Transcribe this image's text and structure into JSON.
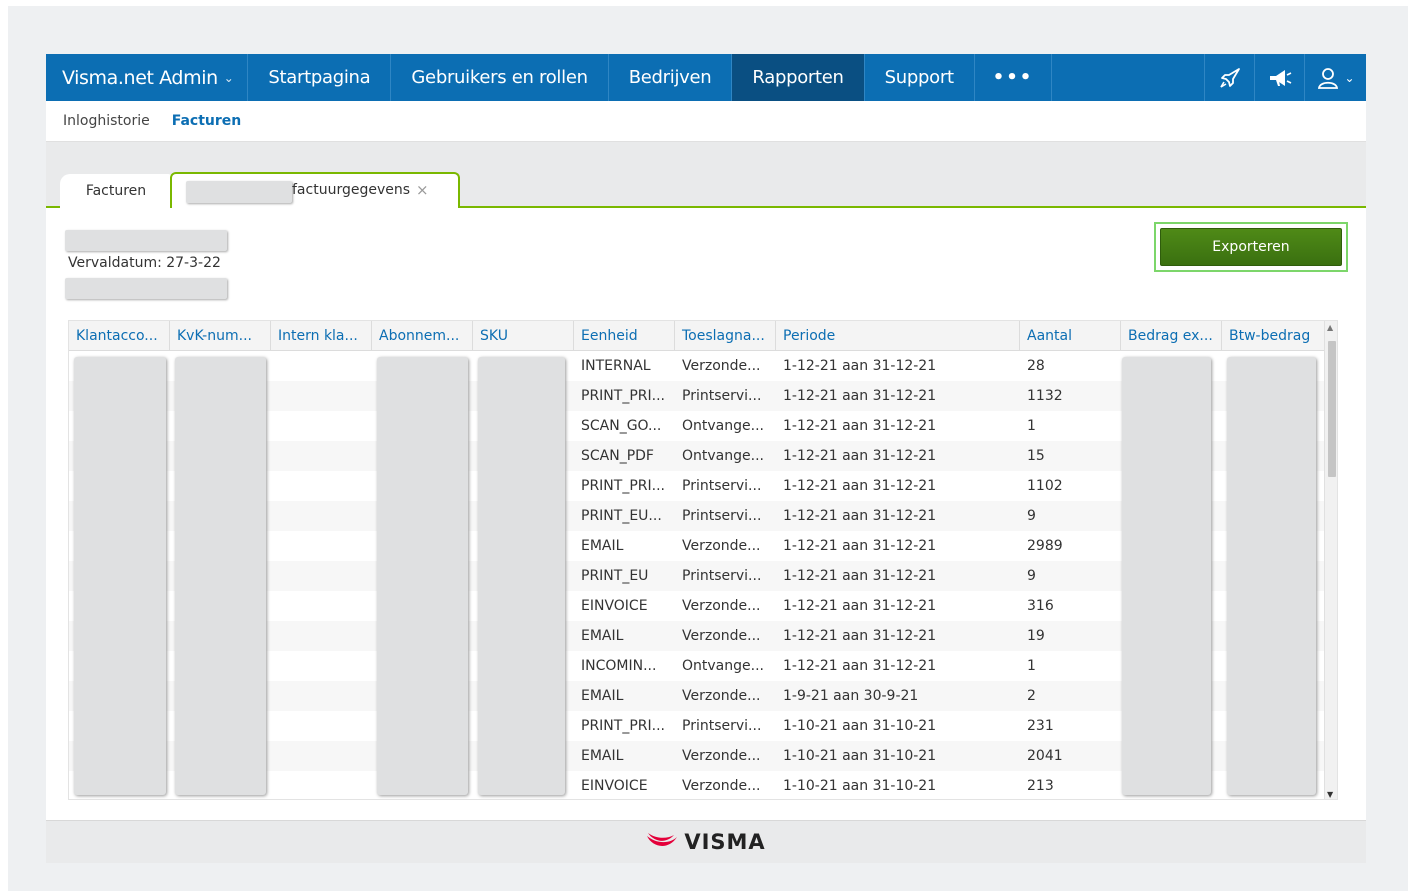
{
  "nav": {
    "brand": "Visma.net Admin",
    "brand_chevron": "⌄",
    "items": [
      {
        "label": "Startpagina"
      },
      {
        "label": "Gebruikers en rollen"
      },
      {
        "label": "Bedrijven"
      },
      {
        "label": "Rapporten"
      },
      {
        "label": "Support"
      }
    ],
    "more": "•••",
    "icons": [
      "rocket-icon",
      "megaphone-icon",
      "user-icon"
    ],
    "user_chevron": "⌄",
    "active": "Rapporten"
  },
  "subnav": {
    "items": [
      {
        "label": "Inloghistorie"
      },
      {
        "label": "Facturen"
      }
    ],
    "active": "Facturen"
  },
  "tabs": {
    "first": "Facturen",
    "second": "factuurgegevens",
    "close": "×"
  },
  "content": {
    "due_date": "Vervaldatum: 27-3-22",
    "export_label": "Exporteren"
  },
  "grid": {
    "columns": [
      "Klantacco...",
      "KvK-num...",
      "Intern kla...",
      "Abonnem...",
      "SKU",
      "Eenheid",
      "Toeslagna...",
      "Periode",
      "Aantal",
      "Bedrag ex...",
      "Btw-bedrag"
    ],
    "rows": [
      {
        "eenheid": "INTERNAL",
        "toeslag": "Verzonde...",
        "periode": "1-12-21 aan 31-12-21",
        "aantal": "28"
      },
      {
        "eenheid": "PRINT_PRI...",
        "toeslag": "Printservi...",
        "periode": "1-12-21 aan 31-12-21",
        "aantal": "1132"
      },
      {
        "eenheid": "SCAN_GO...",
        "toeslag": "Ontvange...",
        "periode": "1-12-21 aan 31-12-21",
        "aantal": "1"
      },
      {
        "eenheid": "SCAN_PDF",
        "toeslag": "Ontvange...",
        "periode": "1-12-21 aan 31-12-21",
        "aantal": "15"
      },
      {
        "eenheid": "PRINT_PRI...",
        "toeslag": "Printservi...",
        "periode": "1-12-21 aan 31-12-21",
        "aantal": "1102"
      },
      {
        "eenheid": "PRINT_EU...",
        "toeslag": "Printservi...",
        "periode": "1-12-21 aan 31-12-21",
        "aantal": "9"
      },
      {
        "eenheid": "EMAIL",
        "toeslag": "Verzonde...",
        "periode": "1-12-21 aan 31-12-21",
        "aantal": "2989"
      },
      {
        "eenheid": "PRINT_EU",
        "toeslag": "Printservi...",
        "periode": "1-12-21 aan 31-12-21",
        "aantal": "9"
      },
      {
        "eenheid": "EINVOICE",
        "toeslag": "Verzonde...",
        "periode": "1-12-21 aan 31-12-21",
        "aantal": "316"
      },
      {
        "eenheid": "EMAIL",
        "toeslag": "Verzonde...",
        "periode": "1-12-21 aan 31-12-21",
        "aantal": "19"
      },
      {
        "eenheid": "INCOMIN...",
        "toeslag": "Ontvange...",
        "periode": "1-12-21 aan 31-12-21",
        "aantal": "1"
      },
      {
        "eenheid": "EMAIL",
        "toeslag": "Verzonde...",
        "periode": "1-9-21 aan 30-9-21",
        "aantal": "2"
      },
      {
        "eenheid": "PRINT_PRI...",
        "toeslag": "Printservi...",
        "periode": "1-10-21 aan 31-10-21",
        "aantal": "231"
      },
      {
        "eenheid": "EMAIL",
        "toeslag": "Verzonde...",
        "periode": "1-10-21 aan 31-10-21",
        "aantal": "2041"
      },
      {
        "eenheid": "EINVOICE",
        "toeslag": "Verzonde...",
        "periode": "1-10-21 aan 31-10-21",
        "aantal": "213"
      }
    ]
  },
  "footer": {
    "logo_text": "VISMA"
  },
  "colors": {
    "nav_bg": "#0c6eb3",
    "nav_active": "#0a4f82",
    "accent_green": "#7ab800",
    "button_green": "#3f7a13",
    "link_blue": "#0c6eb3",
    "logo_red": "#e4003a"
  }
}
